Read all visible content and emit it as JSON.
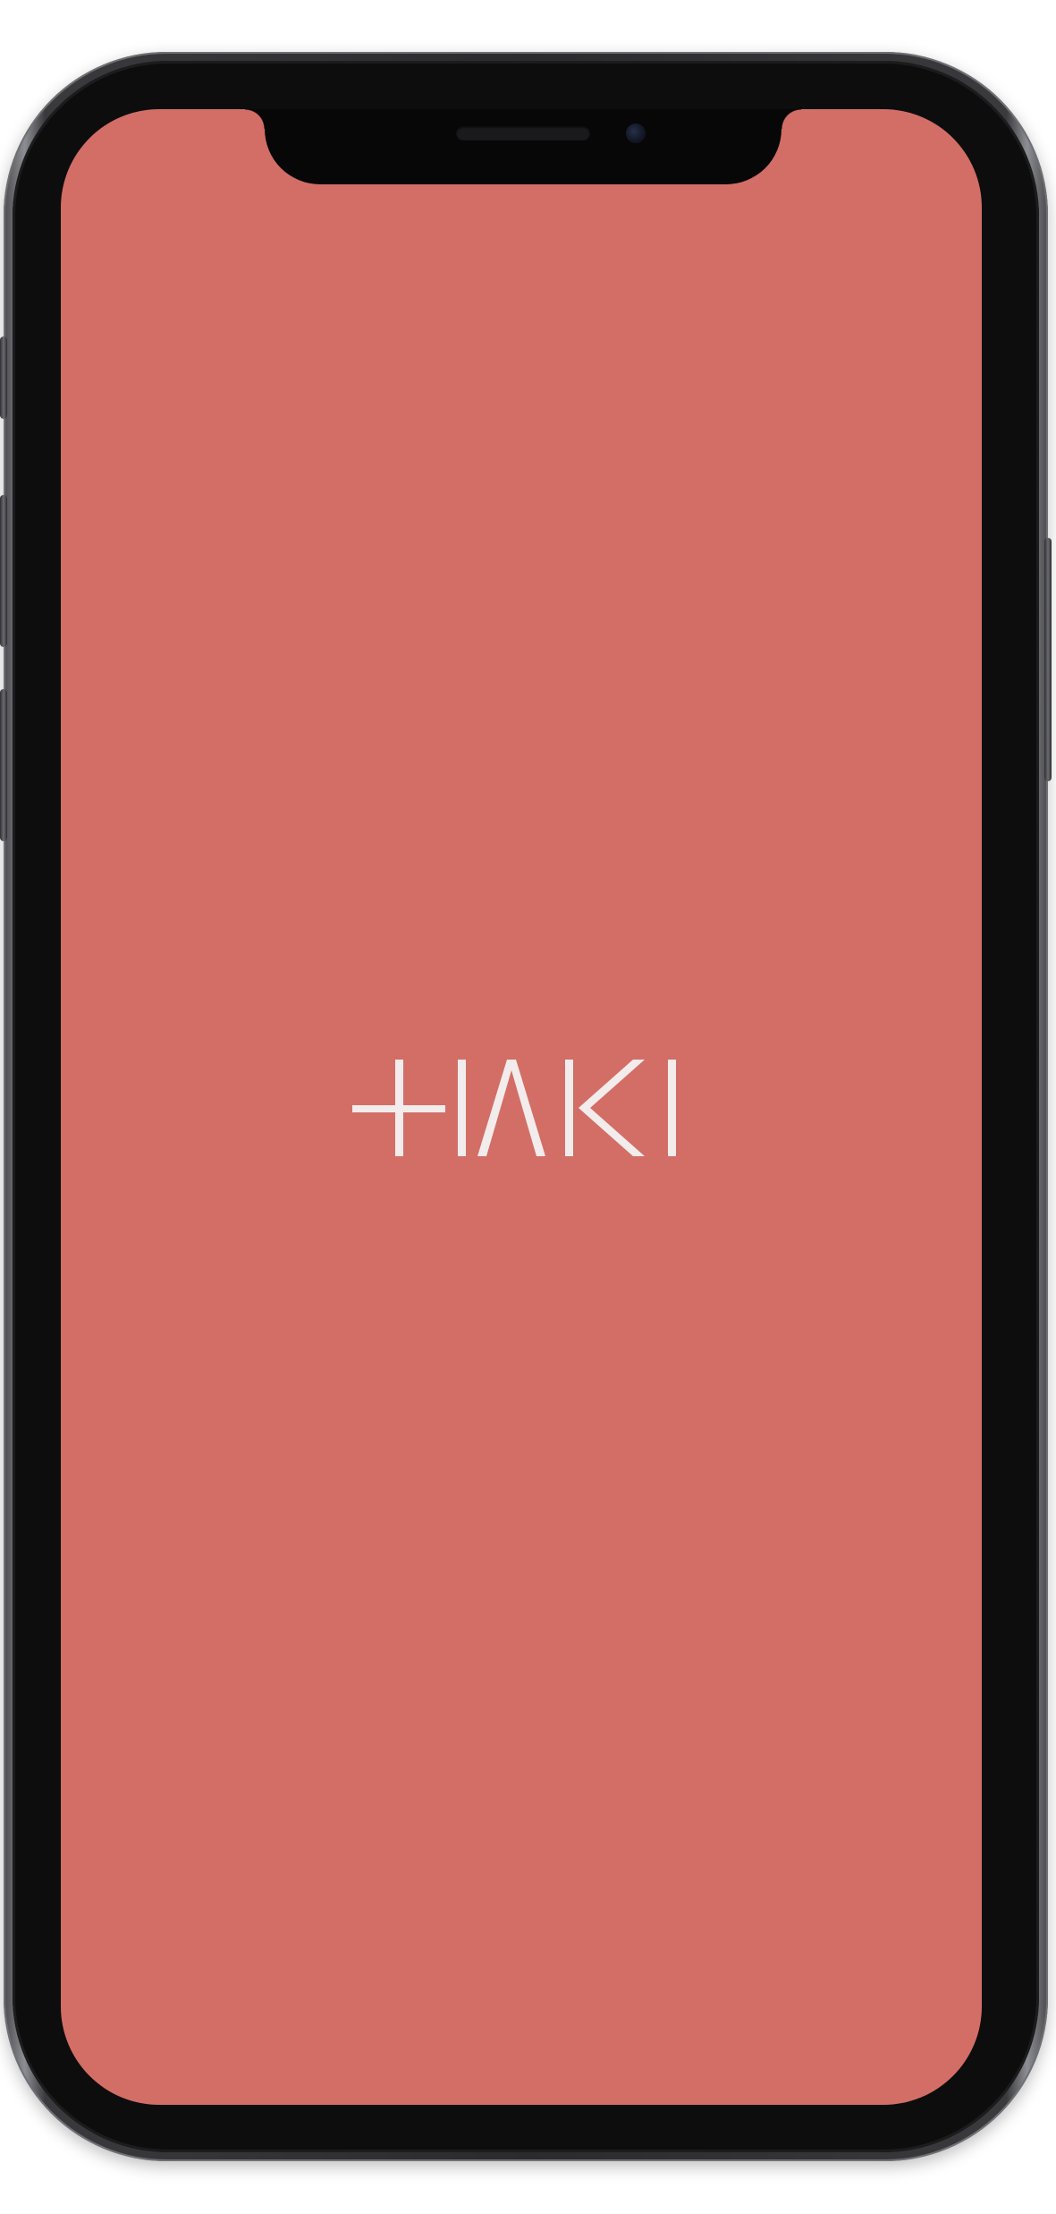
{
  "device": "iphone-x-mockup",
  "screen": {
    "background_color": "#d36e66"
  },
  "logo": {
    "text": "HAKI",
    "color": "#f2ecec"
  }
}
